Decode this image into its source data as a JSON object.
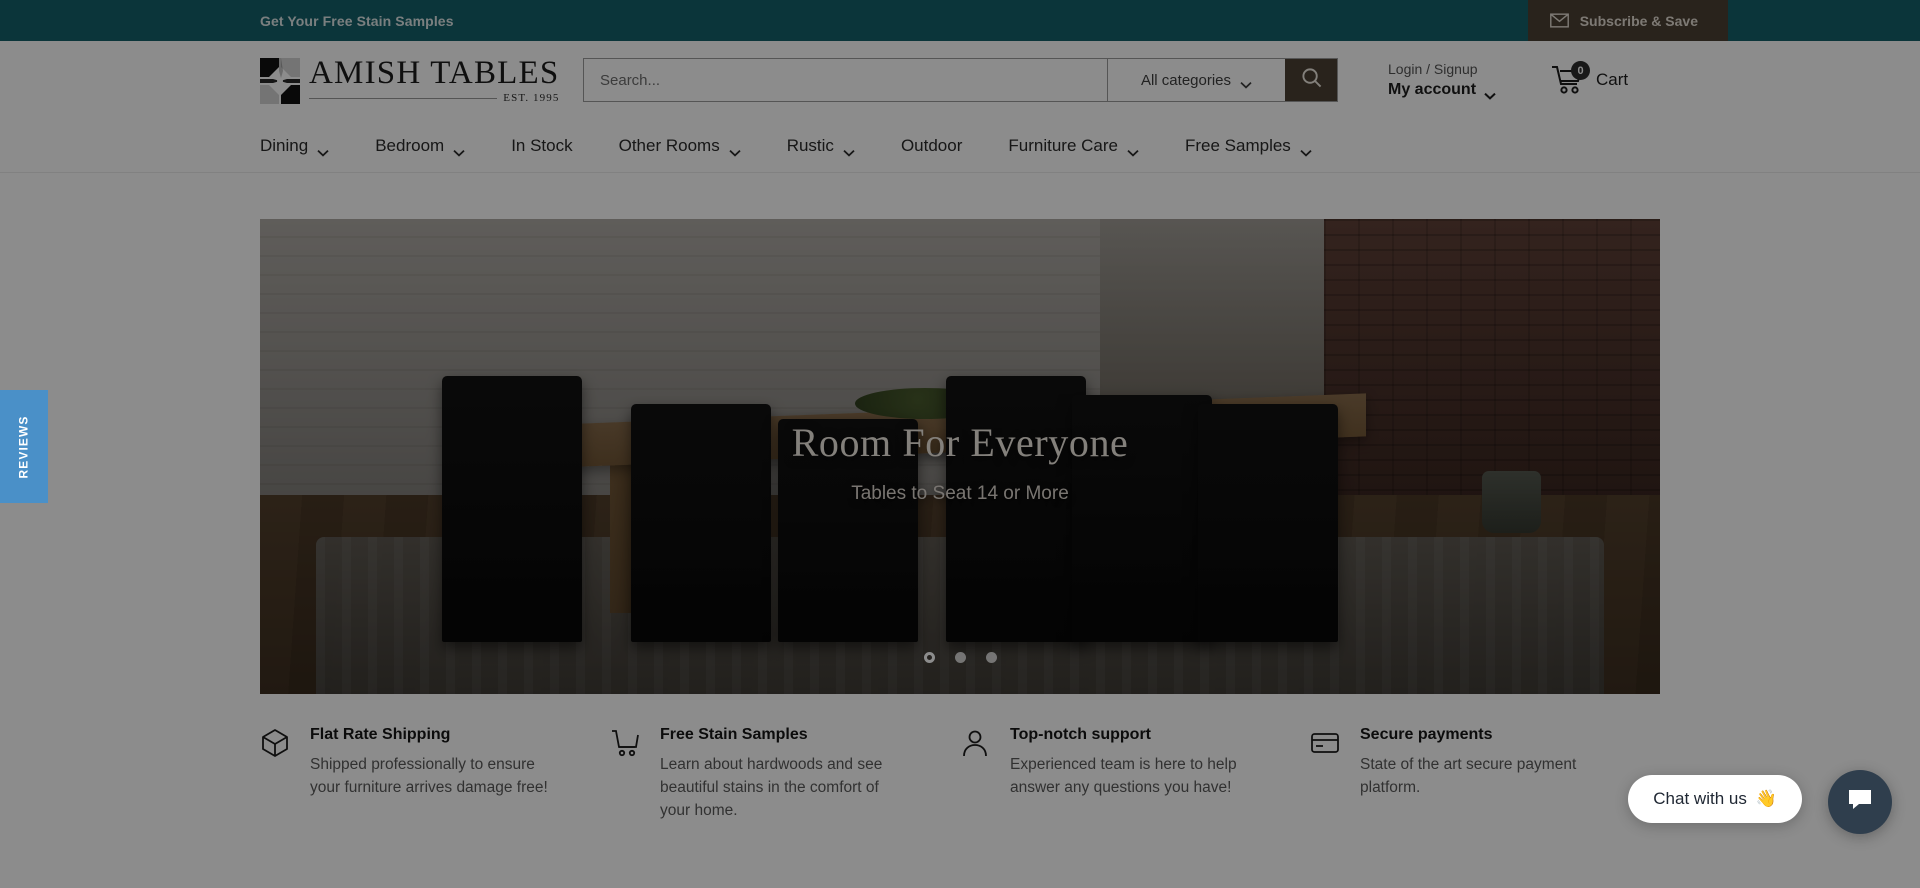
{
  "announcement": {
    "link_label": "Get Your Free Stain Samples",
    "subscribe_label": "Subscribe & Save",
    "bg_color": "#15616b",
    "subscribe_bg_color": "#4b4133"
  },
  "header": {
    "logo": {
      "word": "AMISH TABLES",
      "est": "EST. 1995"
    },
    "search": {
      "placeholder": "Search...",
      "value": "",
      "category_label": "All categories"
    },
    "account": {
      "line1": "Login / Signup",
      "line2": "My account"
    },
    "cart": {
      "label": "Cart",
      "count": "0"
    }
  },
  "nav": {
    "items": [
      {
        "label": "Dining",
        "has_dropdown": true
      },
      {
        "label": "Bedroom",
        "has_dropdown": true
      },
      {
        "label": "In Stock",
        "has_dropdown": false
      },
      {
        "label": "Other Rooms",
        "has_dropdown": true
      },
      {
        "label": "Rustic",
        "has_dropdown": true
      },
      {
        "label": "Outdoor",
        "has_dropdown": false
      },
      {
        "label": "Furniture Care",
        "has_dropdown": true
      },
      {
        "label": "Free Samples",
        "has_dropdown": true
      }
    ]
  },
  "hero": {
    "title": "Room For Everyone",
    "subtitle": "Tables to Seat 14 or More",
    "slides": [
      {
        "active": true
      },
      {
        "active": false
      },
      {
        "active": false
      }
    ]
  },
  "benefits": [
    {
      "icon": "box-icon",
      "title": "Flat Rate Shipping",
      "body": "Shipped professionally to ensure your furniture arrives damage free!"
    },
    {
      "icon": "shopping-cart-icon",
      "title": "Free Stain Samples",
      "body": "Learn about hardwoods and see beautiful stains in the comfort of your home."
    },
    {
      "icon": "user-icon",
      "title": "Top-notch support",
      "body": "Experienced team is here to help answer any questions you have!"
    },
    {
      "icon": "credit-card-icon",
      "title": "Secure payments",
      "body": "State of the art secure payment platform."
    }
  ],
  "reviews_tab": {
    "label": "REVIEWS",
    "color": "#4a90c8"
  },
  "chat": {
    "bubble_text": "Chat with us",
    "bubble_emoji": "👋"
  }
}
